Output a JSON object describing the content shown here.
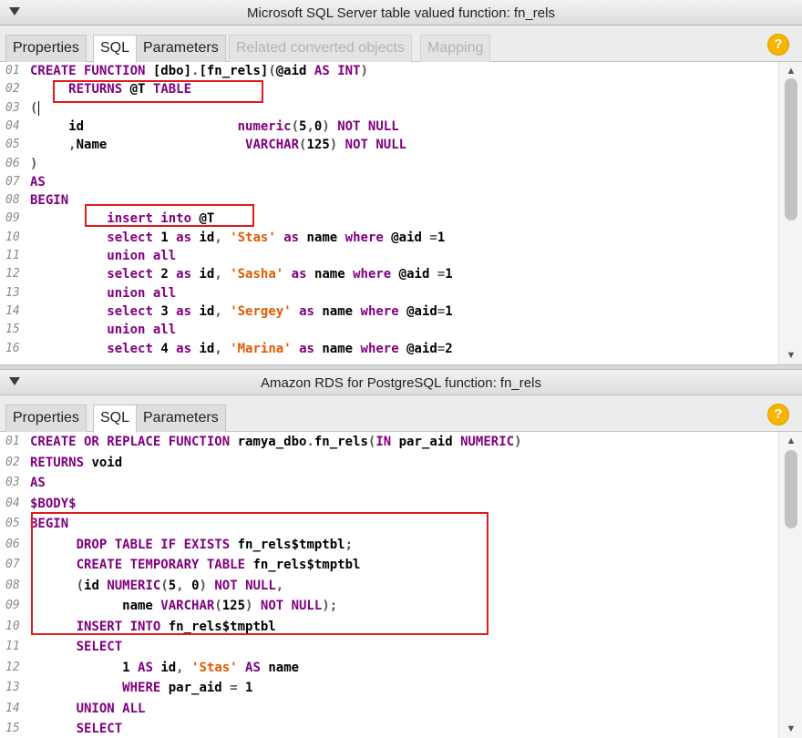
{
  "top_panel": {
    "title": "Microsoft SQL Server table valued function: fn_rels",
    "tabs": [
      {
        "label": "Properties",
        "state": "normal"
      },
      {
        "label": "SQL",
        "state": "active"
      },
      {
        "label": "Parameters",
        "state": "normal"
      },
      {
        "label": "Related converted objects",
        "state": "disabled"
      },
      {
        "label": "Mapping",
        "state": "disabled"
      }
    ],
    "help_label": "?",
    "code": [
      {
        "num": "01",
        "segs": [
          [
            "kw",
            "CREATE FUNCTION "
          ],
          [
            "id",
            "[dbo]"
          ],
          [
            "op",
            "."
          ],
          [
            "id",
            "[fn_rels]"
          ],
          [
            "op",
            "("
          ],
          [
            "id",
            "@aid "
          ],
          [
            "kw",
            "AS INT"
          ],
          [
            "op",
            ")"
          ]
        ]
      },
      {
        "num": "02",
        "segs": [
          [
            "id",
            "     "
          ],
          [
            "kw",
            "RETURNS "
          ],
          [
            "id",
            "@T "
          ],
          [
            "kw",
            "TABLE"
          ]
        ]
      },
      {
        "num": "03",
        "segs": [
          [
            "op",
            "("
          ]
        ],
        "caret": true
      },
      {
        "num": "04",
        "segs": [
          [
            "id",
            "     id                    "
          ],
          [
            "kw",
            "numeric"
          ],
          [
            "op",
            "("
          ],
          [
            "id",
            "5"
          ],
          [
            "op",
            ","
          ],
          [
            "id",
            "0"
          ],
          [
            "op",
            ") "
          ],
          [
            "kw",
            "NOT NULL"
          ]
        ]
      },
      {
        "num": "05",
        "segs": [
          [
            "id",
            "     "
          ],
          [
            "op",
            ","
          ],
          [
            "id",
            "Name                  "
          ],
          [
            "kw",
            "VARCHAR"
          ],
          [
            "op",
            "("
          ],
          [
            "id",
            "125"
          ],
          [
            "op",
            ") "
          ],
          [
            "kw",
            "NOT NULL"
          ]
        ]
      },
      {
        "num": "06",
        "segs": [
          [
            "op",
            ")"
          ]
        ]
      },
      {
        "num": "07",
        "segs": [
          [
            "kw",
            "AS"
          ]
        ]
      },
      {
        "num": "08",
        "segs": [
          [
            "kw",
            "BEGIN"
          ]
        ]
      },
      {
        "num": "09",
        "segs": [
          [
            "id",
            "          "
          ],
          [
            "kw",
            "insert into "
          ],
          [
            "id",
            "@T"
          ]
        ]
      },
      {
        "num": "10",
        "segs": [
          [
            "id",
            "          "
          ],
          [
            "kw",
            "select "
          ],
          [
            "id",
            "1 "
          ],
          [
            "kw",
            "as "
          ],
          [
            "id",
            "id"
          ],
          [
            "op",
            ", "
          ],
          [
            "str",
            "'Stas'"
          ],
          [
            "id",
            " "
          ],
          [
            "kw",
            "as "
          ],
          [
            "id",
            "name "
          ],
          [
            "kw",
            "where "
          ],
          [
            "id",
            "@aid "
          ],
          [
            "op",
            "="
          ],
          [
            "id",
            "1"
          ]
        ]
      },
      {
        "num": "11",
        "segs": [
          [
            "id",
            "          "
          ],
          [
            "kw",
            "union all"
          ]
        ]
      },
      {
        "num": "12",
        "segs": [
          [
            "id",
            "          "
          ],
          [
            "kw",
            "select "
          ],
          [
            "id",
            "2 "
          ],
          [
            "kw",
            "as "
          ],
          [
            "id",
            "id"
          ],
          [
            "op",
            ", "
          ],
          [
            "str",
            "'Sasha'"
          ],
          [
            "id",
            " "
          ],
          [
            "kw",
            "as "
          ],
          [
            "id",
            "name "
          ],
          [
            "kw",
            "where "
          ],
          [
            "id",
            "@aid "
          ],
          [
            "op",
            "="
          ],
          [
            "id",
            "1"
          ]
        ]
      },
      {
        "num": "13",
        "segs": [
          [
            "id",
            "          "
          ],
          [
            "kw",
            "union all"
          ]
        ]
      },
      {
        "num": "14",
        "segs": [
          [
            "id",
            "          "
          ],
          [
            "kw",
            "select "
          ],
          [
            "id",
            "3 "
          ],
          [
            "kw",
            "as "
          ],
          [
            "id",
            "id"
          ],
          [
            "op",
            ", "
          ],
          [
            "str",
            "'Sergey'"
          ],
          [
            "id",
            " "
          ],
          [
            "kw",
            "as "
          ],
          [
            "id",
            "name "
          ],
          [
            "kw",
            "where "
          ],
          [
            "id",
            "@aid"
          ],
          [
            "op",
            "="
          ],
          [
            "id",
            "1"
          ]
        ]
      },
      {
        "num": "15",
        "segs": [
          [
            "id",
            "          "
          ],
          [
            "kw",
            "union all"
          ]
        ]
      },
      {
        "num": "16",
        "segs": [
          [
            "id",
            "          "
          ],
          [
            "kw",
            "select "
          ],
          [
            "id",
            "4 "
          ],
          [
            "kw",
            "as "
          ],
          [
            "id",
            "id"
          ],
          [
            "op",
            ", "
          ],
          [
            "str",
            "'Marina'"
          ],
          [
            "id",
            " "
          ],
          [
            "kw",
            "as "
          ],
          [
            "id",
            "name "
          ],
          [
            "kw",
            "where "
          ],
          [
            "id",
            "@aid"
          ],
          [
            "op",
            "="
          ],
          [
            "id",
            "2"
          ]
        ]
      }
    ]
  },
  "bottom_panel": {
    "title": "Amazon RDS for PostgreSQL function: fn_rels",
    "tabs": [
      {
        "label": "Properties",
        "state": "normal"
      },
      {
        "label": "SQL",
        "state": "active"
      },
      {
        "label": "Parameters",
        "state": "normal"
      }
    ],
    "help_label": "?",
    "code": [
      {
        "num": "01",
        "segs": [
          [
            "kw",
            "CREATE OR REPLACE FUNCTION "
          ],
          [
            "id",
            "ramya_dbo"
          ],
          [
            "op",
            "."
          ],
          [
            "id",
            "fn_rels"
          ],
          [
            "op",
            "("
          ],
          [
            "kw",
            "IN "
          ],
          [
            "id",
            "par_aid "
          ],
          [
            "kw",
            "NUMERIC"
          ],
          [
            "op",
            ")"
          ]
        ]
      },
      {
        "num": "02",
        "segs": [
          [
            "kw",
            "RETURNS "
          ],
          [
            "id",
            "void"
          ]
        ]
      },
      {
        "num": "03",
        "segs": [
          [
            "kw",
            "AS"
          ]
        ]
      },
      {
        "num": "04",
        "segs": [
          [
            "kw",
            "$BODY$"
          ]
        ]
      },
      {
        "num": "05",
        "segs": [
          [
            "kw",
            "BEGIN"
          ]
        ]
      },
      {
        "num": "06",
        "segs": [
          [
            "id",
            "      "
          ],
          [
            "kw",
            "DROP TABLE IF EXISTS "
          ],
          [
            "id",
            "fn_rels$tmptbl"
          ],
          [
            "op",
            ";"
          ]
        ]
      },
      {
        "num": "07",
        "segs": [
          [
            "id",
            "      "
          ],
          [
            "kw",
            "CREATE TEMPORARY TABLE "
          ],
          [
            "id",
            "fn_rels$tmptbl"
          ]
        ]
      },
      {
        "num": "08",
        "segs": [
          [
            "id",
            "      "
          ],
          [
            "op",
            "("
          ],
          [
            "id",
            "id "
          ],
          [
            "kw",
            "NUMERIC"
          ],
          [
            "op",
            "("
          ],
          [
            "id",
            "5"
          ],
          [
            "op",
            ", "
          ],
          [
            "id",
            "0"
          ],
          [
            "op",
            ") "
          ],
          [
            "kw",
            "NOT NULL"
          ],
          [
            "op",
            ","
          ]
        ]
      },
      {
        "num": "09",
        "segs": [
          [
            "id",
            "            name "
          ],
          [
            "kw",
            "VARCHAR"
          ],
          [
            "op",
            "("
          ],
          [
            "id",
            "125"
          ],
          [
            "op",
            ") "
          ],
          [
            "kw",
            "NOT NULL"
          ],
          [
            "op",
            ");"
          ]
        ]
      },
      {
        "num": "10",
        "segs": [
          [
            "id",
            "      "
          ],
          [
            "kw",
            "INSERT INTO "
          ],
          [
            "id",
            "fn_rels$tmptbl"
          ]
        ]
      },
      {
        "num": "11",
        "segs": [
          [
            "id",
            "      "
          ],
          [
            "kw",
            "SELECT"
          ]
        ]
      },
      {
        "num": "12",
        "segs": [
          [
            "id",
            "            1 "
          ],
          [
            "kw",
            "AS "
          ],
          [
            "id",
            "id"
          ],
          [
            "op",
            ", "
          ],
          [
            "str",
            "'Stas'"
          ],
          [
            "id",
            " "
          ],
          [
            "kw",
            "AS "
          ],
          [
            "id",
            "name"
          ]
        ]
      },
      {
        "num": "13",
        "segs": [
          [
            "id",
            "            "
          ],
          [
            "kw",
            "WHERE "
          ],
          [
            "id",
            "par_aid "
          ],
          [
            "op",
            "= "
          ],
          [
            "id",
            "1"
          ]
        ]
      },
      {
        "num": "14",
        "segs": [
          [
            "id",
            "      "
          ],
          [
            "kw",
            "UNION ALL"
          ]
        ]
      },
      {
        "num": "15",
        "segs": [
          [
            "id",
            "      "
          ],
          [
            "kw",
            "SELECT"
          ]
        ]
      }
    ]
  },
  "colors": {
    "keyword": "#800080",
    "string": "#e05a00",
    "highlight_box": "#e01b1b",
    "line_number": "#8a8a8a"
  }
}
